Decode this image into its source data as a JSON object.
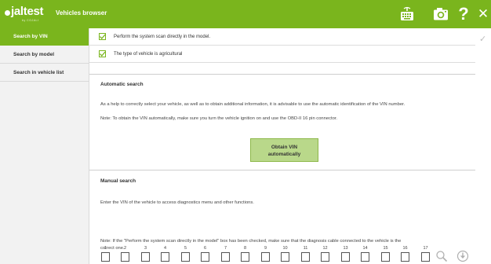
{
  "header": {
    "logo_text": "jaltest",
    "logo_sub": "by COJALI",
    "title": "Vehicles browser",
    "icons": [
      "keyboard-icon",
      "camera-icon",
      "help-icon",
      "close-icon"
    ],
    "help_glyph": "?",
    "close_glyph": "✕"
  },
  "sidebar": {
    "items": [
      {
        "label": "Search by VIN",
        "active": true
      },
      {
        "label": "Search by model",
        "active": false
      },
      {
        "label": "Search in vehicle list",
        "active": false
      }
    ]
  },
  "options": [
    {
      "label": "Perform the system scan directly in the model.",
      "checked": true
    },
    {
      "label": "The type of vehicle is agricultural",
      "checked": true
    }
  ],
  "automatic": {
    "title": "Automatic search",
    "text1": "As a help to correctly select your vehicle, as well as to obtain additional information, it is advisable to use the automatic identification of the VIN number.",
    "text2": "Note: To obtain the VIN automatically, make sure you turn the vehicle ignition on and use the OBD-II 16 pin connector.",
    "button_line1": "Obtain VIN",
    "button_line2": "automatically"
  },
  "manual": {
    "title": "Manual search",
    "text": "Enter the VIN of the vehicle to access diagnostics menu and other functions.",
    "positions": [
      "1",
      "2",
      "3",
      "4",
      "5",
      "6",
      "7",
      "8",
      "9",
      "10",
      "11",
      "12",
      "13",
      "14",
      "15",
      "16",
      "17"
    ],
    "note_line1": "Note: If the \"Perform the system scan directly in the model\" box has been checked, make sure that the diagnosis cable connected to the vehicle is the",
    "note_line2": "correct one."
  },
  "colors": {
    "accent": "#7ab51d",
    "button": "#b9d88a"
  },
  "right_check": "✓"
}
